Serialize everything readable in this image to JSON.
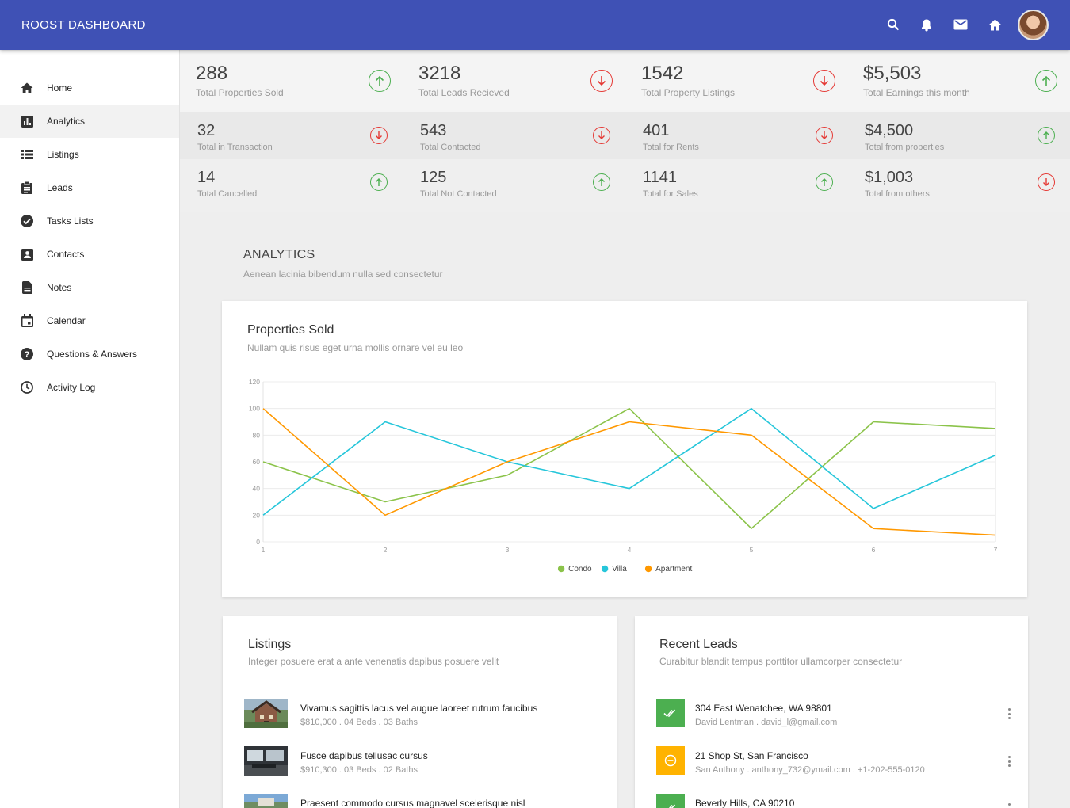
{
  "header": {
    "title": "ROOST DASHBOARD"
  },
  "icons": {
    "search": "search-icon",
    "notifications": "bell-icon",
    "mail": "mail-icon",
    "home": "home-icon",
    "avatar": "user-avatar"
  },
  "colors": {
    "primary": "#3f51b5",
    "up": "#4caf50",
    "down": "#e53935",
    "condo": "#8bc34a",
    "villa": "#26c6da",
    "apartment": "#ff9800"
  },
  "sidebar": {
    "items": [
      {
        "label": "Home",
        "icon": "home-icon"
      },
      {
        "label": "Analytics",
        "icon": "bar-chart-icon",
        "active": true
      },
      {
        "label": "Listings",
        "icon": "list-icon"
      },
      {
        "label": "Leads",
        "icon": "clipboard-icon"
      },
      {
        "label": "Tasks Lists",
        "icon": "check-circle-icon"
      },
      {
        "label": "Contacts",
        "icon": "contact-card-icon"
      },
      {
        "label": "Notes",
        "icon": "note-icon"
      },
      {
        "label": "Calendar",
        "icon": "calendar-icon"
      },
      {
        "label": "Questions & Answers",
        "icon": "help-icon"
      },
      {
        "label": "Activity Log",
        "icon": "clock-icon"
      }
    ]
  },
  "stats": {
    "row1": [
      {
        "value": "288",
        "label": "Total Properties Sold",
        "trend": "up"
      },
      {
        "value": "3218",
        "label": "Total Leads Recieved",
        "trend": "down"
      },
      {
        "value": "1542",
        "label": "Total Property Listings",
        "trend": "down"
      },
      {
        "value": "$5,503",
        "label": "Total Earnings this month",
        "trend": "up"
      }
    ],
    "row2": [
      {
        "value": "32",
        "label": "Total in Transaction",
        "trend": "down"
      },
      {
        "value": "543",
        "label": "Total Contacted",
        "trend": "down"
      },
      {
        "value": "401",
        "label": "Total for Rents",
        "trend": "down"
      },
      {
        "value": "$4,500",
        "label": "Total from properties",
        "trend": "up"
      }
    ],
    "row3": [
      {
        "value": "14",
        "label": "Total Cancelled",
        "trend": "up"
      },
      {
        "value": "125",
        "label": "Total Not Contacted",
        "trend": "up"
      },
      {
        "value": "1141",
        "label": "Total for Sales",
        "trend": "up"
      },
      {
        "value": "$1,003",
        "label": "Total from others",
        "trend": "down"
      }
    ]
  },
  "analytics": {
    "title": "ANALYTICS",
    "subtitle": "Aenean lacinia bibendum nulla sed consectetur"
  },
  "chart_card": {
    "title": "Properties Sold",
    "subtitle": "Nullam quis risus eget urna mollis ornare vel eu leo"
  },
  "chart_data": {
    "type": "line",
    "title": "Properties Sold",
    "x": [
      1,
      2,
      3,
      4,
      5,
      6,
      7
    ],
    "xlim": [
      1,
      7
    ],
    "ylim": [
      0,
      120
    ],
    "yticks": [
      0,
      20,
      40,
      60,
      80,
      100,
      120
    ],
    "grid": true,
    "legend": "bottom-center",
    "series": [
      {
        "name": "Condo",
        "color": "#8bc34a",
        "values": [
          60,
          30,
          50,
          100,
          10,
          90,
          85
        ]
      },
      {
        "name": "Villa",
        "color": "#26c6da",
        "values": [
          20,
          90,
          60,
          40,
          100,
          25,
          65
        ]
      },
      {
        "name": "Apartment",
        "color": "#ff9800",
        "values": [
          100,
          20,
          60,
          90,
          80,
          10,
          5
        ]
      }
    ]
  },
  "listings": {
    "title": "Listings",
    "subtitle": "Integer posuere erat a ante venenatis dapibus posuere velit",
    "items": [
      {
        "title": "Vivamus sagittis lacus vel augue laoreet rutrum faucibus",
        "meta": "$810,000 . 04 Beds . 03 Baths"
      },
      {
        "title": "Fusce dapibus tellusac cursus",
        "meta": "$910,300 . 03 Beds . 02 Baths"
      },
      {
        "title": "Praesent commodo cursus magnavel scelerisque nisl",
        "meta": ""
      }
    ]
  },
  "leads": {
    "title": "Recent Leads",
    "subtitle": "Curabitur blandit tempus porttitor ullamcorper consectetur",
    "items": [
      {
        "title": "304 East Wenatchee, WA 98801",
        "meta": "David Lentman . david_l@gmail.com",
        "status": "done",
        "color": "#4caf50"
      },
      {
        "title": "21 Shop St, San Francisco",
        "meta": "San Anthony . anthony_732@ymail.com . +1-202-555-0120",
        "status": "pending",
        "color": "#ffb300"
      },
      {
        "title": "Beverly Hills, CA 90210",
        "meta": "",
        "status": "done",
        "color": "#4caf50"
      }
    ]
  }
}
